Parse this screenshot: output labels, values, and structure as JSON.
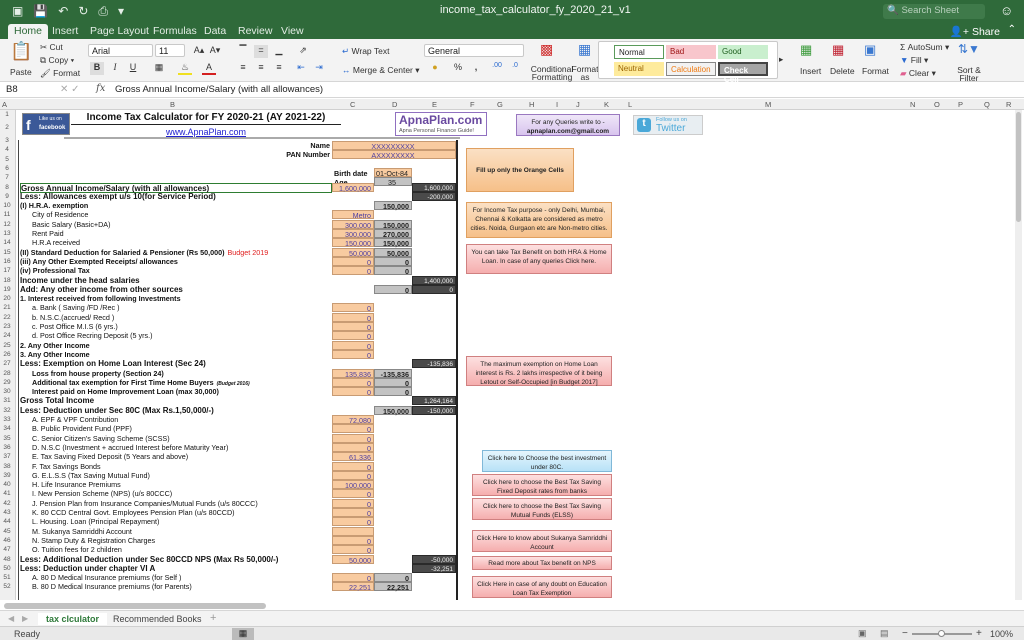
{
  "window": {
    "title": "income_tax_calculator_fy_2020_21_v1",
    "search_placeholder": "Search Sheet"
  },
  "ribbon_tabs": [
    "Home",
    "Insert",
    "Page Layout",
    "Formulas",
    "Data",
    "Review",
    "View"
  ],
  "share_label": "Share",
  "ribbon": {
    "paste": "Paste",
    "cut": "Cut",
    "copy": "Copy",
    "format_painter": "Format",
    "font_name": "Arial",
    "font_size": "11",
    "bold": "B",
    "italic": "I",
    "underline": "U",
    "wrap_text": "Wrap Text",
    "merge_center": "Merge & Center",
    "number_format": "General",
    "percent": "%",
    "comma": ",",
    "conditional_formatting": "Conditional Formatting",
    "format_as_table": "Format as Table",
    "styles": [
      "Normal",
      "Bad",
      "Good",
      "Neutral",
      "Calculation",
      "Check Cell"
    ],
    "insert": "Insert",
    "delete": "Delete",
    "format": "Format",
    "autosum": "AutoSum",
    "fill": "Fill",
    "clear": "Clear",
    "sort_filter": "Sort & Filter"
  },
  "formula_bar": {
    "name_box": "B8",
    "fx": "fx",
    "content": "Gross Annual Income/Salary (with all allowances)"
  },
  "columns": [
    "A",
    "B",
    "C",
    "D",
    "E",
    "F",
    "G",
    "H",
    "I",
    "J",
    "K",
    "L",
    "M",
    "N",
    "O",
    "P",
    "Q",
    "R"
  ],
  "rows": [
    "1",
    "2",
    "3",
    "4",
    "5",
    "6",
    "7",
    "8",
    "9",
    "10",
    "11",
    "12",
    "13",
    "14",
    "15",
    "16",
    "17",
    "18",
    "19",
    "20",
    "21",
    "22",
    "23",
    "24",
    "25",
    "26",
    "27",
    "28",
    "29",
    "30",
    "31",
    "32",
    "33",
    "34",
    "35",
    "36",
    "37",
    "38",
    "39",
    "40",
    "41",
    "42",
    "43",
    "44",
    "45",
    "46",
    "47",
    "48",
    "50",
    "51",
    "52"
  ],
  "sheet": {
    "facebook_badge": {
      "line1": "Like us on",
      "line2": "facebook"
    },
    "title": "Income Tax Calculator for FY 2020-21 (AY 2021-22)",
    "website": "www.ApnaPlan.com",
    "brand": {
      "name": "ApnaPlan.com",
      "tagline": "Apna Personal Finance Guide!"
    },
    "query_note": {
      "line1": "For any Queries write to -",
      "line2": "apnaplan.com@gmail.com"
    },
    "twitter_badge": {
      "line1": "Follow us on",
      "line2": "Twitter"
    },
    "name_label": "Name",
    "name_value": "XXXXXXXXX",
    "pan_label": "PAN Number",
    "pan_value": "AXXXXXXXX",
    "birth_label": "Birth date",
    "birth_value": "01-Oct-84",
    "age_label": "Age",
    "age_value": "35",
    "lines": [
      {
        "row": "8",
        "label": "Gross Annual Income/Salary (with all allowances)",
        "style": "big",
        "c": "1,600,000",
        "e": "1,600,000"
      },
      {
        "row": "9",
        "label": "Less: Allowances exempt u/s 10(for Service Period)",
        "style": "big",
        "e": "-200,000"
      },
      {
        "row": "10",
        "label": "(I) H.R.A. exemption",
        "style": "b",
        "d": "150,000"
      },
      {
        "row": "11",
        "label": "City of Residence",
        "style": "i",
        "c": "Metro"
      },
      {
        "row": "12",
        "label": "Basic Salary (Basic+DA)",
        "style": "i",
        "c": "300,000",
        "d": "150,000"
      },
      {
        "row": "13",
        "label": "Rent Paid",
        "style": "i",
        "c": "300,000",
        "d": "270,000"
      },
      {
        "row": "14",
        "label": "H.R.A received",
        "style": "i",
        "c": "150,000",
        "d": "150,000"
      },
      {
        "row": "15",
        "label": "(II) Standard Deduction for Salaried & Pensioner (Rs 50,000)",
        "extra": "Budget 2019",
        "style": "b",
        "c": "50,000",
        "d": "50,000"
      },
      {
        "row": "16",
        "label": "(iii) Any Other Exempted Receipts/ allowances",
        "style": "b",
        "c": "0",
        "d": "0"
      },
      {
        "row": "17",
        "label": "(iv) Professional Tax",
        "style": "b",
        "c": "0",
        "d": "0"
      },
      {
        "row": "18",
        "label": "Income under the head salaries",
        "style": "big",
        "e": "1,400,000"
      },
      {
        "row": "19",
        "label": "Add: Any other income from other sources",
        "style": "big",
        "d": "0",
        "e": "0"
      },
      {
        "row": "20",
        "label": "1. Interest received from following Investments",
        "style": "b"
      },
      {
        "row": "21",
        "label": "a. Bank ( Saving /FD /Rec )",
        "style": "i",
        "c": "0"
      },
      {
        "row": "22",
        "label": "b. N.S.C.(accrued/ Recd )",
        "style": "i",
        "c": "0"
      },
      {
        "row": "23",
        "label": "c. Post Office M.I.S (6 yrs.)",
        "style": "i",
        "c": "0"
      },
      {
        "row": "24",
        "label": "d. Post Office Recring Deposit (5 yrs.)",
        "style": "i",
        "c": "0"
      },
      {
        "row": "25",
        "label": "2. Any Other Income",
        "style": "b",
        "c": "0"
      },
      {
        "row": "26",
        "label": "3. Any Other Income",
        "style": "b",
        "c": "0"
      },
      {
        "row": "27",
        "label": "Less: Exemption on Home Loan Interest (Sec 24)",
        "style": "big",
        "e": "-135,836"
      },
      {
        "row": "28",
        "label": "Loss from house property (Section 24)",
        "style": "bi",
        "c": "135,836",
        "d": "-135,836"
      },
      {
        "row": "29",
        "label": "Additional tax exemption for First Time Home Buyers",
        "extra": "(Budget 2016)",
        "style": "bi",
        "c": "0",
        "d": "0"
      },
      {
        "row": "30",
        "label": "Interest paid on Home Improvement Loan (max 30,000)",
        "style": "bi",
        "c": "0",
        "d": "0"
      },
      {
        "row": "31",
        "label": "Gross Total Income",
        "style": "big",
        "e": "1,264,164"
      },
      {
        "row": "32",
        "label": "Less: Deduction under Sec 80C (Max Rs.1,50,000/-)",
        "style": "big",
        "d": "150,000",
        "e": "-150,000"
      },
      {
        "row": "33",
        "label": "A. EPF & VPF Contribution",
        "style": "i",
        "c": "72,080"
      },
      {
        "row": "34",
        "label": "B. Public Provident Fund (PPF)",
        "style": "i",
        "c": "0"
      },
      {
        "row": "35",
        "label": "C. Senior Citizen's Saving Scheme (SCSS)",
        "style": "i",
        "c": "0"
      },
      {
        "row": "36",
        "label": "D. N.S.C (Investment + accrued Interest before Maturity Year)",
        "style": "i",
        "c": "0"
      },
      {
        "row": "37",
        "label": "E. Tax Saving Fixed Deposit (5 Years and above)",
        "style": "i",
        "c": "61,336"
      },
      {
        "row": "38",
        "label": "F. Tax Savings Bonds",
        "style": "i",
        "c": "0"
      },
      {
        "row": "39",
        "label": "G. E.L.S.S (Tax Saving Mutual Fund)",
        "style": "i",
        "c": "0"
      },
      {
        "row": "40",
        "label": "H. Life Insurance Premiums",
        "style": "i",
        "c": "100,000"
      },
      {
        "row": "41",
        "label": "I. New Pension Scheme (NPS) (u/s 80CCC)",
        "style": "i",
        "c": "0"
      },
      {
        "row": "42",
        "label": "J. Pension Plan from Insurance Companies/Mutual Funds (u/s 80CCC)",
        "style": "i",
        "c": "0"
      },
      {
        "row": "43",
        "label": "K. 80 CCD Central Govt. Employees Pension Plan (u/s 80CCD)",
        "style": "i",
        "c": "0"
      },
      {
        "row": "44",
        "label": "L. Housing. Loan (Principal Repayment)",
        "style": "i",
        "c": "0"
      },
      {
        "row": "45",
        "label": "M. Sukanya Samriddhi Account",
        "style": "i",
        "c": ""
      },
      {
        "row": "46",
        "label": "N. Stamp Duty & Registration Charges",
        "style": "i",
        "c": "0"
      },
      {
        "row": "47",
        "label": "O. Tuition fees for 2 children",
        "style": "i",
        "c": "0"
      },
      {
        "row": "48",
        "label": "Less: Additional Deduction under Sec 80CCD NPS (Max Rs 50,000/-)",
        "style": "big",
        "c": "50,000",
        "e": "-50,000"
      },
      {
        "row": "50",
        "label": "Less: Deduction under chapter VI A",
        "style": "big",
        "e": "-32,251"
      },
      {
        "row": "51",
        "label": "A. 80 D Medical Insurance premiums (for Self )",
        "style": "i",
        "c": "0",
        "d": "0"
      },
      {
        "row": "52",
        "label": "B. 80 D Medical Insurance premiums (for Parents)",
        "style": "i",
        "c": "22,251",
        "d": "22,251"
      }
    ],
    "notes": {
      "orange_cells": "Fill up only the Orange Cells",
      "metro": "For Income Tax purpose - only Delhi, Mumbai, Chennai & Kolkatta are considered as metro cities. Noida, Gurgaon etc are Non-metro cities.",
      "hra_home": "You can take Tax Benefit on both HRA & Home Loan. In case of any queries Click here.",
      "home_loan": "The maximum exemption on Home Loan interest is Rs. 2 lakhs irrespective of it being Letout or Self-Occupied [in Budget 2017]",
      "best_80c": "Click here to Choose the best investment under 80C.",
      "fd_rates": "Click here to choose the Best Tax Saving Fixed Deposit rates from banks",
      "elss": "Click here to choose the Best Tax Saving Mutual Funds (ELSS)",
      "sukanya": "Click Here to know about Sukanya Samriddhi Account",
      "nps": "Read more about Tax benefit on NPS",
      "edu_loan": "Click Here in case of any doubt on Education Loan Tax Exemption"
    }
  },
  "sheet_tabs": [
    "tax clculator",
    "Recommended Books"
  ],
  "add_sheet": "+",
  "status": {
    "ready": "Ready",
    "zoom": "100%",
    "zoom_fraction": 0.5
  }
}
